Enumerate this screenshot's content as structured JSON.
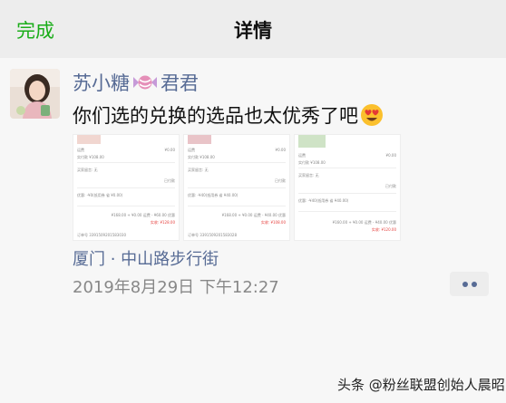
{
  "nav": {
    "done_label": "完成",
    "title": "详情"
  },
  "post": {
    "author_part1": "苏小糖",
    "author_part2": "君君",
    "text": "你们选的兑换的选品也太优秀了吧",
    "emoji_icon": "smiling-face-with-heart-eyes-icon",
    "candy_icon": "candy-icon",
    "location": "厦门 · 中山路步行街",
    "time": "2019年8月29日  下午12:27"
  },
  "thumbs": [
    {
      "r1": "运费",
      "r1v": "¥0.00",
      "r2": "实付款 ¥108.00",
      "r3": "买家留言: 无",
      "r4": "已付款",
      "r5": "优惠: -¥0(抵用券 省 ¥0.00)",
      "r6": "¥168.00 + ¥0.00 运费 - ¥60.00 优惠",
      "r7": "实收: ¥128.00",
      "r8": "订单号 3391509201583030"
    },
    {
      "r1": "运费",
      "r1v": "¥0.00",
      "r2": "实付款 ¥108.00",
      "r3": "买家留言: 无",
      "r4": "已付款",
      "r5": "优惠: -¥40(抵用券 省 ¥40.00)",
      "r6": "¥168.00 + ¥0.00 运费 - ¥40.00 优惠",
      "r7": "实收: ¥108.00",
      "r8": "订单号 3391509201583028"
    },
    {
      "r1": "运费",
      "r1v": "¥0.00",
      "r2": "实付款 ¥108.00",
      "r3": "买家留言: 无",
      "r4": "已付款",
      "r5": "优惠: -¥40(抵用券 省 ¥40.00)",
      "r6": "¥160.00 + ¥0.00 运费 - ¥40.00 优惠",
      "r7": "实收: ¥120.00",
      "r8": ""
    }
  ],
  "watermark": "头条 @粉丝联盟创始人晨昭",
  "colors": {
    "link": "#576b95",
    "done": "#1aad19",
    "price_red": "#e64340"
  }
}
